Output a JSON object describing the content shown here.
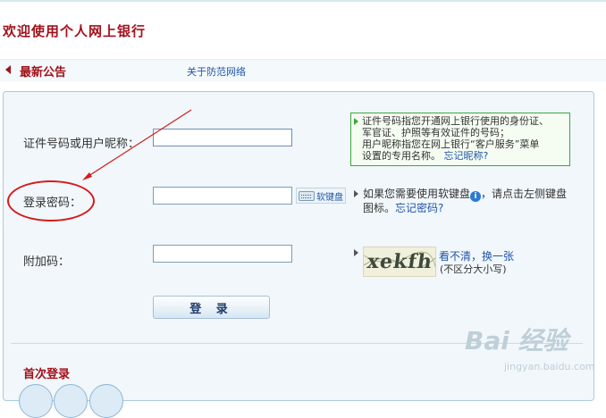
{
  "header": {
    "welcome": "欢迎使用个人网上银行"
  },
  "notice": {
    "title": "最新公告",
    "link": "关于防范网络"
  },
  "form": {
    "user_label": "证件号码或用户昵称：",
    "password_label": "登录密码：",
    "addcode_label": "附加码：",
    "user_value": "",
    "password_value": "",
    "addcode_value": "",
    "soft_keyboard_label": "软键盘",
    "login_button": "登 录"
  },
  "hints": {
    "user_hint_1": "证件号码指您开通网上银行使用的身份证、",
    "user_hint_2": "军官证、护照等有效证件的号码；",
    "user_hint_3": "用户昵称指您在网上银行“客户服务”菜单",
    "user_hint_4": "设置的专用名称。",
    "forgot_nickname": "忘记昵称?",
    "pwd_hint_1": "如果您需要使用软键盘",
    "pwd_hint_2": "，请点击左侧键盘",
    "pwd_hint_3": "图标。",
    "forgot_password": "忘记密码?"
  },
  "captcha": {
    "text": "xekfh",
    "refresh_link": "看不清，换一张",
    "case_note": "(不区分大小写)"
  },
  "first_login": {
    "title": "首次登录"
  },
  "watermark": {
    "brand": "Bai 经验",
    "url": "jingyan.baidu.com"
  },
  "colors": {
    "brand_red": "#a3101a",
    "link_blue": "#1f55a8",
    "annotation_red": "#d51b1b",
    "hint_green": "#39a93b"
  }
}
